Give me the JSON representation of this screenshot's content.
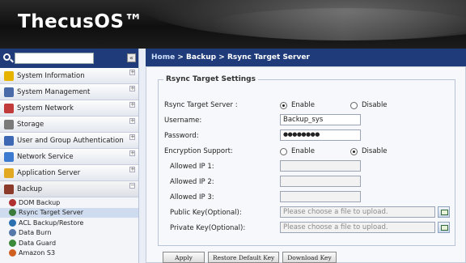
{
  "app": {
    "logo": "ThecusOS™"
  },
  "search": {
    "value": ""
  },
  "sidebar": {
    "collapse_glyph": "«",
    "categories": [
      {
        "label": "System Information",
        "color": "#e6b400"
      },
      {
        "label": "System Management",
        "color": "#4a6aa8"
      },
      {
        "label": "System Network",
        "color": "#c23b3b"
      },
      {
        "label": "Storage",
        "color": "#7a7a7a"
      },
      {
        "label": "User and Group Authentication",
        "color": "#3e67b4"
      },
      {
        "label": "Network Service",
        "color": "#3d7bd0"
      },
      {
        "label": "Application Server",
        "color": "#e3a821"
      },
      {
        "label": "Backup",
        "color": "#8c3a2a"
      }
    ],
    "backup_items": [
      {
        "label": "DOM Backup",
        "color": "#b03030"
      },
      {
        "label": "Rsync Target Server",
        "color": "#3a7a3a"
      },
      {
        "label": "ACL Backup/Restore",
        "color": "#2a6fb0"
      },
      {
        "label": "Data Burn",
        "color": "#5577aa"
      },
      {
        "label": "Data Guard",
        "color": "#3a8a3a"
      },
      {
        "label": "Amazon S3",
        "color": "#d06020"
      }
    ]
  },
  "breadcrumb": {
    "home": "Home",
    "sep1": " > ",
    "backup": "Backup",
    "sep2": " > ",
    "current": "Rsync Target Server"
  },
  "form": {
    "legend": "Rsync Target Settings",
    "rsync_label": "Rsync Target Server :",
    "enable": "Enable",
    "disable": "Disable",
    "username_label": "Username:",
    "username_value": "Backup_sys",
    "password_label": "Password:",
    "password_value": "●●●●●●●●",
    "encryption_label": "Encryption Support:",
    "allowed_ip1": "Allowed IP 1:",
    "allowed_ip2": "Allowed IP 2:",
    "allowed_ip3": "Allowed IP 3:",
    "public_key_label": "Public Key(Optional):",
    "private_key_label": "Private Key(Optional):",
    "file_placeholder": "Please choose a file to upload."
  },
  "buttons": {
    "apply": "Apply",
    "restore": "Restore Default Key",
    "download": "Download Key"
  }
}
